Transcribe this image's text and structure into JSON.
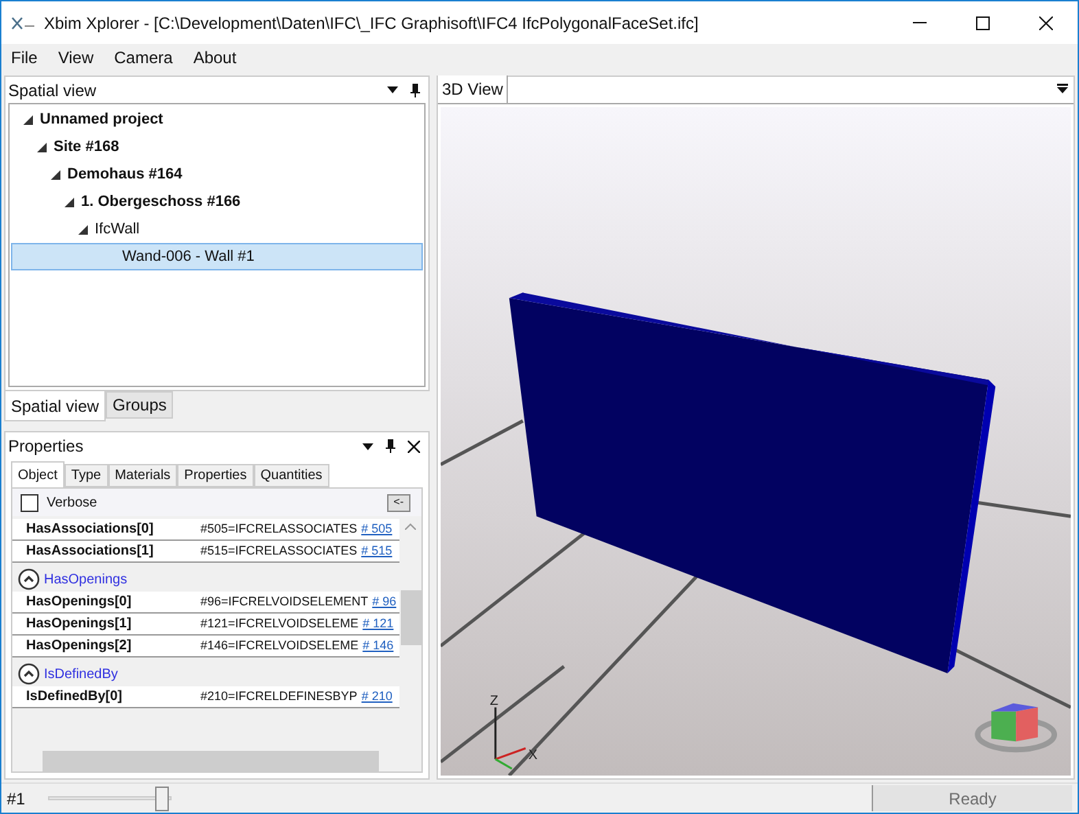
{
  "window": {
    "title": "Xbim Xplorer - [C:\\Development\\Daten\\IFC\\_IFC Graphisoft\\IFC4 IfcPolygonalFaceSet.ifc]"
  },
  "menu": [
    "File",
    "View",
    "Camera",
    "About"
  ],
  "spatial_panel": {
    "title": "Spatial view",
    "tree": [
      {
        "label": "Unnamed project",
        "bold": true,
        "expanded": true,
        "selected": false,
        "children": [
          {
            "label": "Site #168",
            "bold": true,
            "expanded": true,
            "selected": false,
            "children": [
              {
                "label": "Demohaus #164",
                "bold": true,
                "expanded": true,
                "selected": false,
                "children": [
                  {
                    "label": "1. Obergeschoss #166",
                    "bold": true,
                    "expanded": true,
                    "selected": false,
                    "children": [
                      {
                        "label": "IfcWall",
                        "bold": false,
                        "expanded": true,
                        "selected": false,
                        "children": [
                          {
                            "label": "Wand-006 - Wall #1",
                            "bold": false,
                            "expanded": false,
                            "selected": true
                          }
                        ]
                      }
                    ]
                  }
                ]
              }
            ]
          }
        ]
      }
    ],
    "tabs": [
      {
        "label": "Spatial view",
        "selected": true
      },
      {
        "label": "Groups",
        "selected": false
      }
    ]
  },
  "properties_panel": {
    "title": "Properties",
    "tabs": [
      {
        "label": "Object",
        "selected": true
      },
      {
        "label": "Type",
        "selected": false
      },
      {
        "label": "Materials",
        "selected": false
      },
      {
        "label": "Properties",
        "selected": false
      },
      {
        "label": "Quantities",
        "selected": false
      }
    ],
    "verbose": {
      "label": "Verbose",
      "checked": false
    },
    "back_button": "<-",
    "groups": [
      {
        "expanded": true,
        "rows": [
          {
            "name": "HasAssociations[0]",
            "value": "#505=IFCRELASSOCIATES",
            "link": "# 505"
          },
          {
            "name": "HasAssociations[1]",
            "value": "#515=IFCRELASSOCIATES",
            "link": "# 515"
          }
        ]
      },
      {
        "title": "HasOpenings",
        "expanded": true,
        "rows": [
          {
            "name": "HasOpenings[0]",
            "value": "#96=IFCRELVOIDSELEMENT",
            "link": "# 96"
          },
          {
            "name": "HasOpenings[1]",
            "value": "#121=IFCRELVOIDSELEME",
            "link": "# 121"
          },
          {
            "name": "HasOpenings[2]",
            "value": "#146=IFCRELVOIDSELEME",
            "link": "# 146"
          }
        ]
      },
      {
        "title": "IsDefinedBy",
        "expanded": true,
        "rows": [
          {
            "name": "IsDefinedBy[0]",
            "value": "#210=IFCRELDEFINESBYP",
            "link": "# 210"
          }
        ]
      }
    ]
  },
  "view_panel": {
    "tabs": [
      {
        "label": "3D View",
        "selected": true
      }
    ],
    "axes": {
      "z": "Z",
      "x": "X"
    }
  },
  "status_bar": {
    "label": "#1",
    "slider": {
      "level": 0.92
    },
    "status": "Ready"
  }
}
